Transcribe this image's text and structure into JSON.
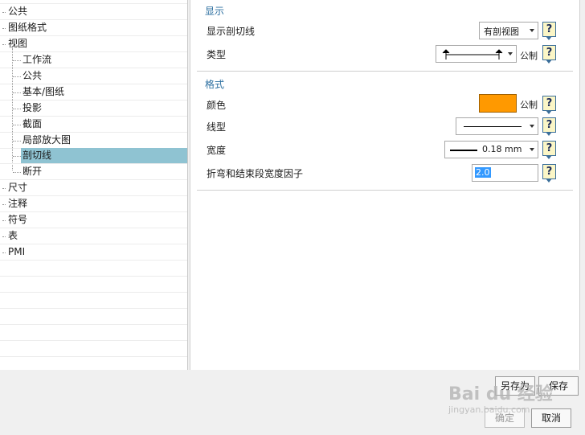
{
  "tree": {
    "items": [
      {
        "label": "公共",
        "level": 0
      },
      {
        "label": "图纸格式",
        "level": 0
      },
      {
        "label": "视图",
        "level": 0
      },
      {
        "label": "工作流",
        "level": 1
      },
      {
        "label": "公共",
        "level": 1
      },
      {
        "label": "基本/图纸",
        "level": 1
      },
      {
        "label": "投影",
        "level": 1
      },
      {
        "label": "截面",
        "level": 1
      },
      {
        "label": "局部放大图",
        "level": 1
      },
      {
        "label": "剖切线",
        "level": 1,
        "selected": true
      },
      {
        "label": "断开",
        "level": 1
      },
      {
        "label": "尺寸",
        "level": 0
      },
      {
        "label": "注释",
        "level": 0
      },
      {
        "label": "符号",
        "level": 0
      },
      {
        "label": "表",
        "level": 0
      },
      {
        "label": "PMI",
        "level": 0
      }
    ]
  },
  "display_group": {
    "title": "显示",
    "show_section_line_label": "显示剖切线",
    "show_section_line_value": "有剖视图",
    "type_label": "类型",
    "type_unit": "公制"
  },
  "format_group": {
    "title": "格式",
    "color_label": "颜色",
    "color_value": "#ff9900",
    "color_unit": "公制",
    "linetype_label": "线型",
    "width_label": "宽度",
    "width_value": "0.18 mm",
    "bend_factor_label": "折弯和结束段宽度因子",
    "bend_factor_value": "2.0"
  },
  "help_glyph": "?",
  "buttons": {
    "save_as": "另存为",
    "save": "保存",
    "ok": "确定",
    "cancel": "取消"
  },
  "watermark": {
    "text": "Bai du 经验",
    "url": "jingyan.baidu.com"
  }
}
